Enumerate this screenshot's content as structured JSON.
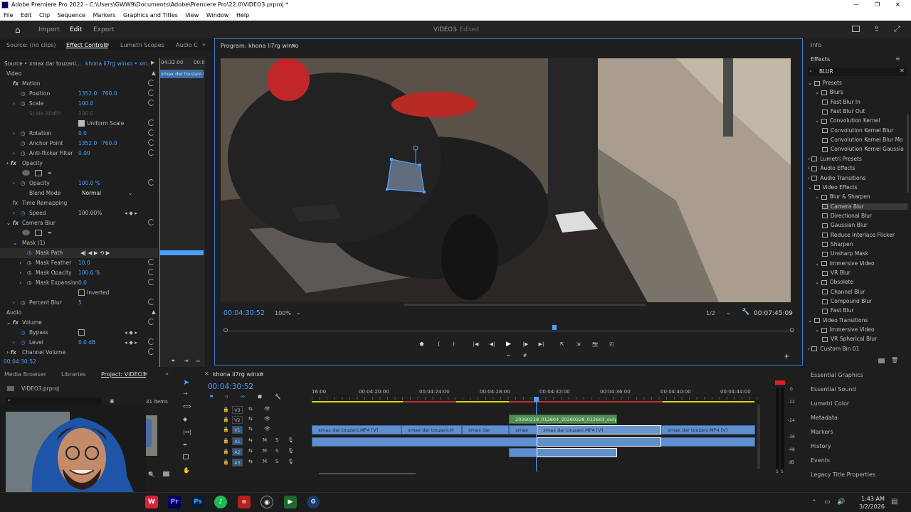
{
  "window": {
    "title": "Adobe Premiere Pro 2022 - C:\\Users\\GWW9\\Documents\\Adobe\\Premiere Pro\\22.0\\VIDEO3.prproj *"
  },
  "menu": [
    "File",
    "Edit",
    "Clip",
    "Sequence",
    "Markers",
    "Graphics and Titles",
    "View",
    "Window",
    "Help"
  ],
  "header": {
    "tabs": [
      "Import",
      "Edit",
      "Export"
    ],
    "active": "Edit",
    "project_title": "VIDEO3",
    "status": "- Edited"
  },
  "effect_controls": {
    "tabs": [
      "Source: (no clips)",
      "Effect Controls",
      "Lumetri Scopes",
      "Audio C"
    ],
    "source_label": "Source • xmax dar touzani...",
    "clip_label": "khona li7rg winxo • xm...",
    "mini_timecode": "04:32:00",
    "mini_timecode2": "00:0",
    "mini_clip": "xmax dar touzani.i",
    "section_video": "Video",
    "section_audio": "Audio",
    "rows": [
      {
        "label": "Motion",
        "v1": "",
        "v2": ""
      },
      {
        "label": "Position",
        "v1": "1352.0",
        "v2": "760.0"
      },
      {
        "label": "Scale",
        "v1": "100.0",
        "v2": ""
      },
      {
        "label": "Scale Width",
        "v1": "100.0",
        "v2": ""
      },
      {
        "label": "Uniform Scale",
        "v1": "",
        "v2": ""
      },
      {
        "label": "Rotation",
        "v1": "0.0",
        "v2": ""
      },
      {
        "label": "Anchor Point",
        "v1": "1352.0",
        "v2": "760.0"
      },
      {
        "label": "Anti-flicker Filter",
        "v1": "0.00",
        "v2": ""
      },
      {
        "label": "Opacity",
        "v1": "",
        "v2": ""
      },
      {
        "label": "Opacity",
        "v1": "100.0 %",
        "v2": ""
      },
      {
        "label": "Blend Mode",
        "v1": "Normal",
        "v2": ""
      },
      {
        "label": "Time Remapping",
        "v1": "",
        "v2": ""
      },
      {
        "label": "Speed",
        "v1": "100.00%",
        "v2": ""
      },
      {
        "label": "Camera Blur",
        "v1": "",
        "v2": ""
      },
      {
        "label": "Mask (1)",
        "v1": "",
        "v2": ""
      },
      {
        "label": "Mask Path",
        "v1": "",
        "v2": ""
      },
      {
        "label": "Mask Feather",
        "v1": "10.0",
        "v2": ""
      },
      {
        "label": "Mask Opacity",
        "v1": "100.0 %",
        "v2": ""
      },
      {
        "label": "Mask Expansion",
        "v1": "0.0",
        "v2": ""
      },
      {
        "label": "Inverted",
        "v1": "",
        "v2": ""
      },
      {
        "label": "Percent Blur",
        "v1": "5",
        "v2": ""
      },
      {
        "label": "Volume",
        "v1": "",
        "v2": ""
      },
      {
        "label": "Bypass",
        "v1": "",
        "v2": ""
      },
      {
        "label": "Level",
        "v1": "0.0 dB",
        "v2": ""
      },
      {
        "label": "Channel Volume",
        "v1": "",
        "v2": ""
      }
    ],
    "timecode": "00:04:30:52"
  },
  "program": {
    "tab": "Program: khona li7rg winxo",
    "timecode": "00:04:30:52",
    "zoom": "100%",
    "resolution": "1/2",
    "duration": "00:07:45:09"
  },
  "effects": {
    "info_tab": "Info",
    "tab": "Effects",
    "search": "BLUR",
    "tree": [
      {
        "label": "Presets",
        "level": 0
      },
      {
        "label": "Blurs",
        "level": 1
      },
      {
        "label": "Fast Blur In",
        "level": 2
      },
      {
        "label": "Fast Blur Out",
        "level": 2
      },
      {
        "label": "Convolution Kernel",
        "level": 1
      },
      {
        "label": "Convolution Kernel Blur",
        "level": 2
      },
      {
        "label": "Convolution Kernel Blur Mo",
        "level": 2
      },
      {
        "label": "Convolution Kernel Gaussia",
        "level": 2
      },
      {
        "label": "Lumetri Presets",
        "level": 0
      },
      {
        "label": "Audio Effects",
        "level": 0
      },
      {
        "label": "Audio Transitions",
        "level": 0
      },
      {
        "label": "Video Effects",
        "level": 0
      },
      {
        "label": "Blur & Sharpen",
        "level": 1
      },
      {
        "label": "Camera Blur",
        "level": 2
      },
      {
        "label": "Directional Blur",
        "level": 2
      },
      {
        "label": "Gaussian Blur",
        "level": 2
      },
      {
        "label": "Reduce Interlace Flicker",
        "level": 2
      },
      {
        "label": "Sharpen",
        "level": 2
      },
      {
        "label": "Unsharp Mask",
        "level": 2
      },
      {
        "label": "Immersive Video",
        "level": 1
      },
      {
        "label": "VR Blur",
        "level": 2
      },
      {
        "label": "Obsolete",
        "level": 1
      },
      {
        "label": "Channel Blur",
        "level": 2
      },
      {
        "label": "Compound Blur",
        "level": 2
      },
      {
        "label": "Fast Blur",
        "level": 2
      },
      {
        "label": "Video Transitions",
        "level": 0
      },
      {
        "label": "Immersive Video",
        "level": 1
      },
      {
        "label": "VR Spherical Blur",
        "level": 2
      },
      {
        "label": "Custom Bin 01",
        "level": 0
      }
    ],
    "selected": "Camera Blur"
  },
  "right_panels": [
    "Essential Graphics",
    "Essential Sound",
    "Lumetri Color",
    "Metadata",
    "Markers",
    "History",
    "Events",
    "Legacy Title Properties"
  ],
  "project": {
    "tabs": [
      "Media Browser",
      "Libraries",
      "Project: VIDEO3"
    ],
    "file": "VIDEO3.prproj",
    "items": "31 items"
  },
  "timeline": {
    "tab": "khona li7rg winxo",
    "timecode": "00:04:30:52",
    "ruler": [
      "16:00",
      "00:04:20:00",
      "00:04:24:00",
      "00:04:28:00",
      "00:04:32:00",
      "00:04:36:00",
      "00:04:40:00",
      "00:04:44:00"
    ],
    "tracks": [
      "V3",
      "V2",
      "V1",
      "A1",
      "A2",
      "A3"
    ],
    "v2_clip": "20260228_012604_20260228_012603_output.m",
    "v1_clips": [
      "xmax dar touzani.MP4 [V]",
      "xmax dar touzani.M",
      "xmax dar",
      "xmax",
      "xmax dar touzani.MP4 [V]",
      "xmax dar touzani.MP4 [V]"
    ]
  },
  "meter": {
    "labels": [
      "0",
      "-12",
      "-24",
      "-36",
      "-48",
      "dB"
    ]
  },
  "taskbar": {
    "time": "1:43 AM",
    "date": "3/2/2026"
  }
}
